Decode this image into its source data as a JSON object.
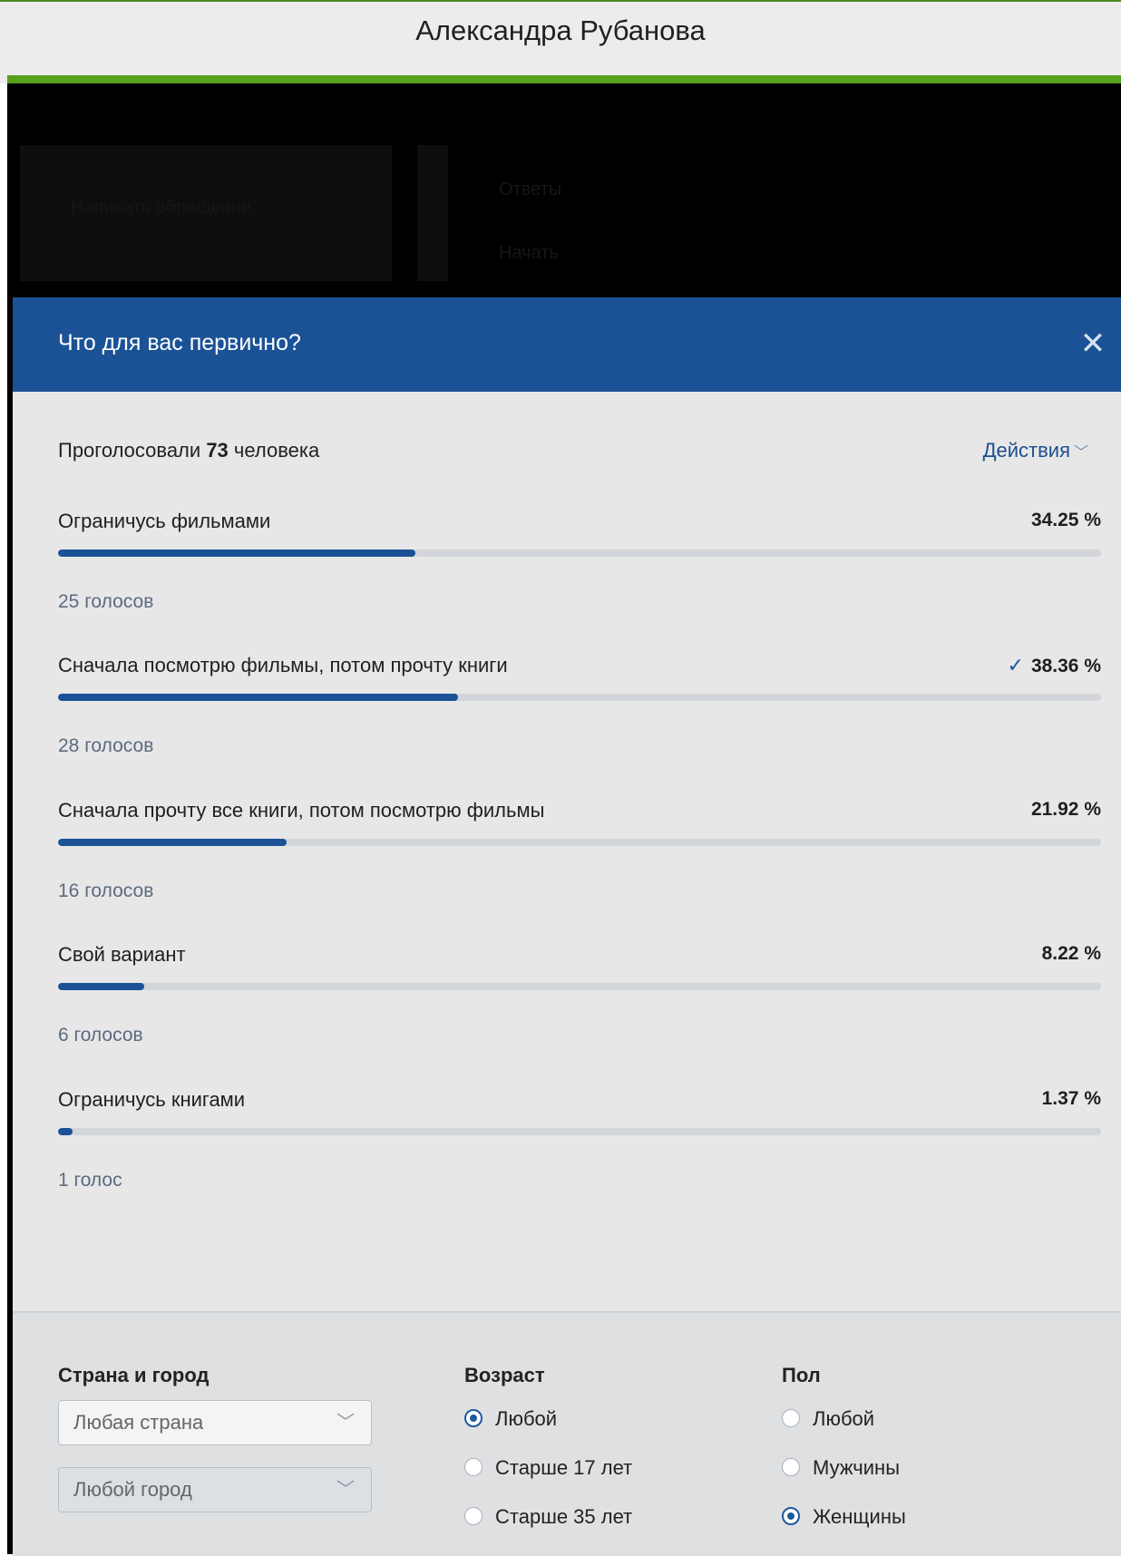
{
  "window": {
    "title": "Александра Рубанова"
  },
  "background_page": {
    "sidebar_item": "Написать обращение",
    "menu_items": [
      "Ответы",
      "Начать"
    ]
  },
  "poll": {
    "title": "Что для вас первично?",
    "voted_prefix": "Проголосовали",
    "voted_count": "73",
    "voted_suffix": "человека",
    "actions_label": "Действия",
    "options": [
      {
        "label": "Ограничусь фильмами",
        "percent_text": "34.25 %",
        "percent": 34.25,
        "votes": "25 голосов",
        "selected": false
      },
      {
        "label": "Сначала посмотрю фильмы, потом прочту книги",
        "percent_text": "38.36 %",
        "percent": 38.36,
        "votes": "28 голосов",
        "selected": true
      },
      {
        "label": "Сначала прочту все книги, потом посмотрю фильмы",
        "percent_text": "21.92 %",
        "percent": 21.92,
        "votes": "16 голосов",
        "selected": false
      },
      {
        "label": "Свой вариант",
        "percent_text": "8.22 %",
        "percent": 8.22,
        "votes": "6 голосов",
        "selected": false
      },
      {
        "label": "Ограничусь книгами",
        "percent_text": "1.37 %",
        "percent": 1.37,
        "votes": "1 голос",
        "selected": false
      }
    ]
  },
  "filters": {
    "country_city": {
      "heading": "Страна и город",
      "country_value": "Любая страна",
      "city_value": "Любой город"
    },
    "age": {
      "heading": "Возраст",
      "options": [
        "Любой",
        "Старше 17 лет",
        "Старше 35 лет"
      ],
      "selected": 0
    },
    "gender": {
      "heading": "Пол",
      "options": [
        "Любой",
        "Мужчины",
        "Женщины"
      ],
      "selected": 2
    }
  },
  "colors": {
    "header_blue": "#1b5296",
    "bar_fill": "#1b5296",
    "accent_green": "#57a21c"
  }
}
